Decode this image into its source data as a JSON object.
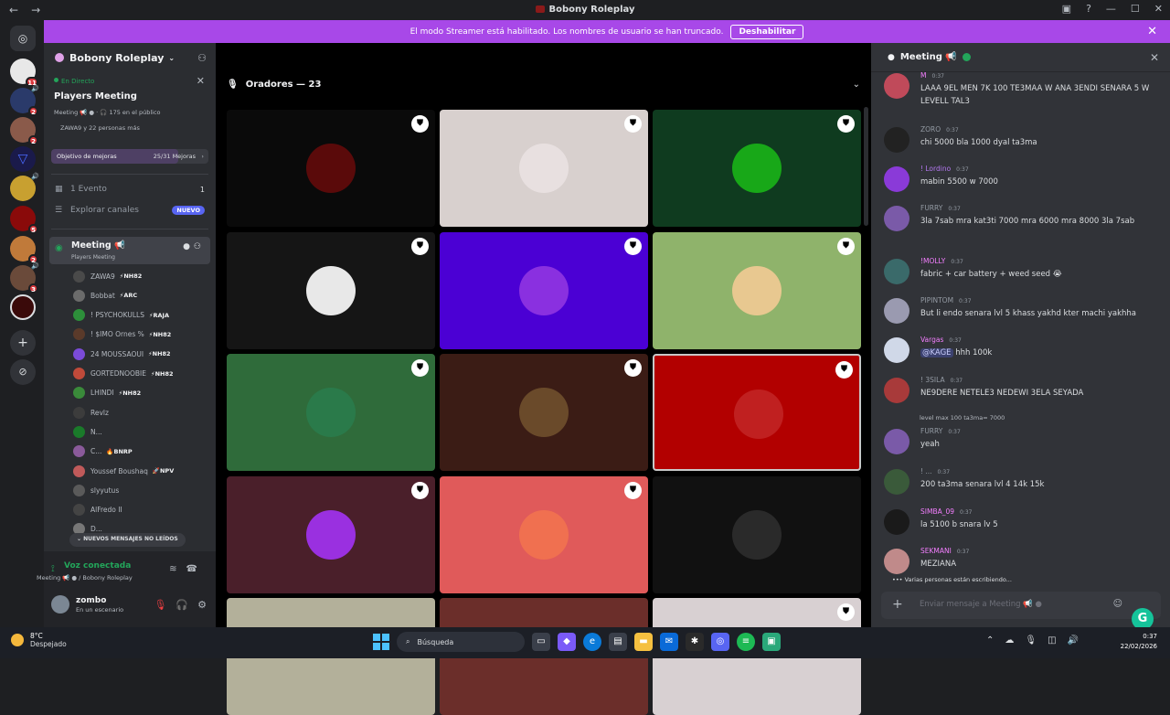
{
  "window": {
    "title": "Bobony Roleplay"
  },
  "banner": {
    "text": "El modo Streamer está habilitado. Los nombres de usuario se han truncado.",
    "button": "Deshabilitar"
  },
  "guild_badges": [
    "11",
    "2",
    "2",
    "2",
    "5",
    "2",
    "3"
  ],
  "sidebar": {
    "server_name": "Bobony Roleplay",
    "live_label": "En Directo",
    "event_title": "Players Meeting",
    "event_meta": "Meeting 📢 ● · 🎧 175 en el público",
    "event_meta2": "ZAWA9 y 22 personas más",
    "boost_label": "Objetivo de mejoras",
    "boost_progress": "25/31 Mejoras",
    "boost_fraction": 0.81,
    "events_label": "1 Evento",
    "events_count": "1",
    "explore_label": "Explorar canales",
    "explore_badge": "NUEVO",
    "voice_channel": {
      "name": "Meeting 📢",
      "sub": "Players Meeting"
    },
    "voice_users": [
      {
        "name": "ZAWA9",
        "tag": "⚡NH82",
        "color": "#4a4a4a"
      },
      {
        "name": "Bobbat",
        "tag": "⚡ARC",
        "color": "#6b6b6b"
      },
      {
        "name": "! PSYCHOKULLS",
        "tag": "⚡RAJA",
        "color": "#2d8f3a"
      },
      {
        "name": "! $IMO Ornes %",
        "tag": "⚡NH82",
        "color": "#5a3a2a"
      },
      {
        "name": "24 MOUSSAOUI",
        "tag": "⚡NH82",
        "color": "#7b4bd8"
      },
      {
        "name": "GORTEDNOOBIE",
        "tag": "⚡NH82",
        "color": "#c04a3a"
      },
      {
        "name": "LHINDI",
        "tag": "⚡NH82",
        "color": "#3a8a3a"
      },
      {
        "name": "Revlz",
        "tag": "",
        "color": "#3c3c3c"
      },
      {
        "name": "N...",
        "tag": "",
        "color": "#1a7a2a"
      },
      {
        "name": "C...",
        "tag": "🔥BNRP",
        "color": "#8a5a9a"
      },
      {
        "name": "Youssef Boushaq",
        "tag": "🚀NPV",
        "color": "#c05a5a"
      },
      {
        "name": "slyyutus",
        "tag": "",
        "color": "#5a5a5a"
      },
      {
        "name": "AlFredo II",
        "tag": "",
        "color": "#444"
      },
      {
        "name": "D...",
        "tag": "",
        "color": "#777"
      }
    ],
    "unread_label": "NUEVOS MENSAJES NO LEÍDOS",
    "voice_connected": "Voz conectada",
    "voice_connected_sub": "Meeting 📢 ● / Bobony Roleplay",
    "user_name": "zombo",
    "user_status": "En un escenario"
  },
  "stage": {
    "header": "Oradores — 23",
    "tiles_bg": [
      "#0a0a0a",
      "#d8d0ce",
      "#0f3b1f",
      "#151515",
      "#4b00d4",
      "#8fb36b",
      "#2f6b3a",
      "#3b1c15",
      "#b20000",
      "#4a1f2a",
      "#e05a5a",
      "#111111",
      "#b3b09a",
      "#6b2e2a",
      "#d8d0d2"
    ]
  },
  "chat": {
    "title": "Meeting 📢",
    "messages": [
      {
        "name": "M",
        "time": "0:37",
        "text": "LAAA 9EL MEN 7K 100 TE3MAA W ANA 3ENDI SENARA 5 W LEVELL TAL3",
        "color": "#f47fff",
        "av": "#c04a5a"
      },
      {
        "name": "ZORO",
        "time": "0:37",
        "text": "chi 5000 bla 1000 dyal ta3ma",
        "color": "#949ba4",
        "av": "#222"
      },
      {
        "name": "! Lordino",
        "time": "0:37",
        "text": "mabin 5500 w 7000",
        "color": "#b378f0",
        "av": "#8a3ad8"
      },
      {
        "name": "FURRY",
        "time": "0:37",
        "text": "3la 7sab mra kat3ti 7000 mra 6000 mra 8000 3la 7sab",
        "color": "#949ba4",
        "av": "#7a5aa8"
      },
      {
        "name": "!MOLLY",
        "time": "0:37",
        "text": "fabric + car battery + weed seed 😭",
        "color": "#f47fff",
        "av": "#3a6a6a"
      },
      {
        "name": "PIPINTOM",
        "time": "0:37",
        "text": "But li endo senara lvl 5 khass yakhd kter machi yakhha",
        "color": "#949ba4",
        "av": "#9a9ab0"
      },
      {
        "name": "Vargas",
        "time": "0:37",
        "text": "hhh 100k",
        "mention": "@KAGE",
        "color": "#f47fff",
        "av": "#d0d8e8"
      },
      {
        "name": "! 3SILA",
        "time": "0:37",
        "text": "NE9DERE NETELE3 NEDEWI 3ELA SEYADA",
        "color": "#949ba4",
        "av": "#a83a3a"
      },
      {
        "name": "FURRY",
        "time": "0:37",
        "text": "yeah",
        "color": "#949ba4",
        "av": "#7a5aa8"
      },
      {
        "name": "! ...",
        "time": "0:37",
        "text": "200 ta3ma senara lvl 4 14k 15k",
        "color": "#949ba4",
        "av": "#3a5a3a"
      },
      {
        "name": "SIMBA_09",
        "time": "0:37",
        "text": "la 5100 b snara lv 5",
        "color": "#f47fff",
        "av": "#1a1a1a"
      },
      {
        "name": "SEKMANI",
        "time": "0:37",
        "text": "MEZIANA",
        "color": "#f47fff",
        "av": "#c08a8a"
      }
    ],
    "reply_preview": "level max 100 ta3ma= 7000",
    "typing": "Varias personas están escribiendo...",
    "placeholder": "Enviar mensaje a Meeting 📢 ●"
  },
  "taskbar": {
    "temp": "8°C",
    "weather": "Despejado",
    "search": "Búsqueda",
    "time": "0:37",
    "date": "22/02/2026"
  }
}
